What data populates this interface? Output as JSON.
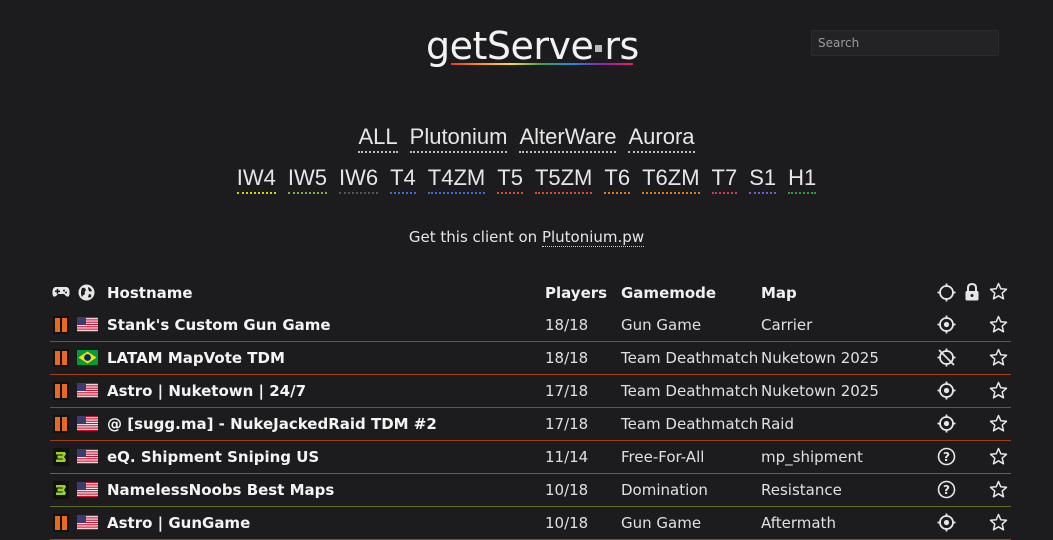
{
  "header": {
    "logo_text_a": "getServe",
    "logo_text_b": "rs",
    "search_placeholder": "Search"
  },
  "nav": {
    "clients": [
      "ALL",
      "Plutonium",
      "AlterWare",
      "Aurora"
    ],
    "games": [
      {
        "label": "IW4",
        "color": "#d4d400"
      },
      {
        "label": "IW5",
        "color": "#7ab23a"
      },
      {
        "label": "IW6",
        "color": "#555555"
      },
      {
        "label": "T4",
        "color": "#3b6fd6"
      },
      {
        "label": "T4ZM",
        "color": "#3b6fd6"
      },
      {
        "label": "T5",
        "color": "#d4502a"
      },
      {
        "label": "T5ZM",
        "color": "#d4502a"
      },
      {
        "label": "T6",
        "color": "#e07a1f"
      },
      {
        "label": "T6ZM",
        "color": "#e07a1f"
      },
      {
        "label": "T7",
        "color": "#d23a5a"
      },
      {
        "label": "S1",
        "color": "#7a5ad6"
      },
      {
        "label": "H1",
        "color": "#2f9e3e"
      }
    ]
  },
  "client_line": {
    "prefix": "Get this client on ",
    "link": "Plutonium.pw"
  },
  "table": {
    "headers": {
      "hostname": "Hostname",
      "players": "Players",
      "gamemode": "Gamemode",
      "map": "Map"
    },
    "rows": [
      {
        "game_icon": "bo2-icon",
        "flag": "us",
        "hostname": "Stank's Custom Gun Game",
        "players": "18/18",
        "gamemode": "Gun Game",
        "map": "Carrier",
        "status": "target-icon"
      },
      {
        "game_icon": "bo2-icon",
        "flag": "br",
        "hostname": "LATAM MapVote TDM",
        "players": "18/18",
        "gamemode": "Team Deathmatch",
        "map": "Nuketown 2025",
        "status": "target-off-icon"
      },
      {
        "game_icon": "bo2-icon",
        "flag": "us",
        "hostname": "Astro | Nuketown | 24/7",
        "players": "17/18",
        "gamemode": "Team Deathmatch",
        "map": "Nuketown 2025",
        "status": "target-icon"
      },
      {
        "game_icon": "bo2-icon",
        "flag": "us",
        "hostname": "@ [sugg.ma] - NukeJackedRaid TDM #2",
        "players": "17/18",
        "gamemode": "Team Deathmatch",
        "map": "Raid",
        "status": "target-icon"
      },
      {
        "game_icon": "mw3-icon",
        "flag": "us",
        "hostname": "eQ. Shipment Sniping US",
        "players": "11/14",
        "gamemode": "Free-For-All",
        "map": "mp_shipment",
        "status": "question-icon"
      },
      {
        "game_icon": "mw3-icon",
        "flag": "us",
        "hostname": "NamelessNoobs Best Maps",
        "players": "10/18",
        "gamemode": "Domination",
        "map": "Resistance",
        "status": "question-icon"
      },
      {
        "game_icon": "bo2-icon",
        "flag": "us",
        "hostname": "Astro | GunGame",
        "players": "10/18",
        "gamemode": "Gun Game",
        "map": "Aftermath",
        "status": "target-icon"
      }
    ]
  }
}
